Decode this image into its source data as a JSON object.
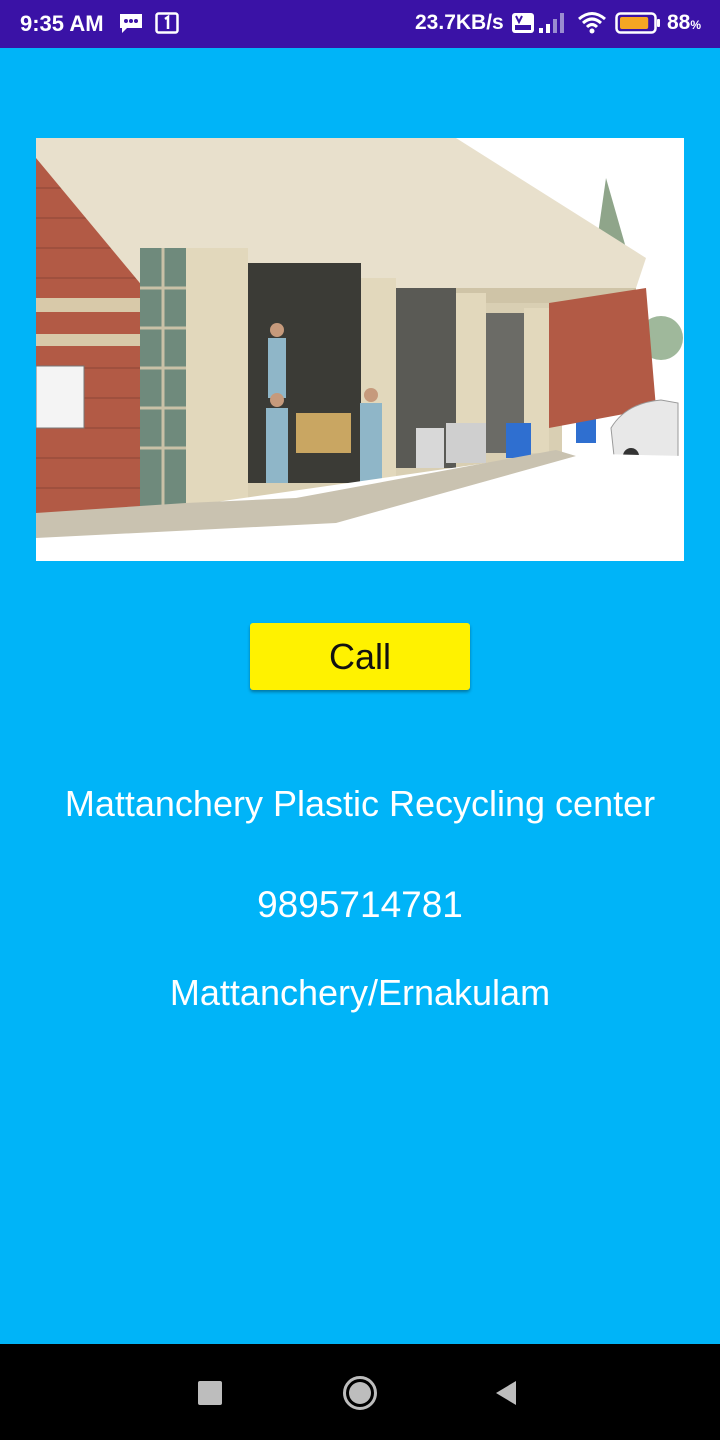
{
  "status_bar": {
    "time": "9:35 AM",
    "network_speed": "23.7KB/s",
    "battery_percent": "88",
    "battery_unit": "%",
    "battery_level": 0.88,
    "icons": [
      "message-icon",
      "sim-icon",
      "volte-icon",
      "signal-icon",
      "wifi-icon",
      "battery-icon"
    ]
  },
  "main": {
    "call_label": "Call",
    "center_name": "Mattanchery Plastic Recycling center",
    "phone": "9895714781",
    "location": "Mattanchery/Ernakulam"
  },
  "colors": {
    "background": "#00B4F8",
    "status_bar": "#3A12A6",
    "call_button": "#FFF200",
    "nav_bar": "#000000"
  },
  "nav_bar": {
    "icons": [
      "recents-icon",
      "home-icon",
      "back-icon"
    ]
  }
}
